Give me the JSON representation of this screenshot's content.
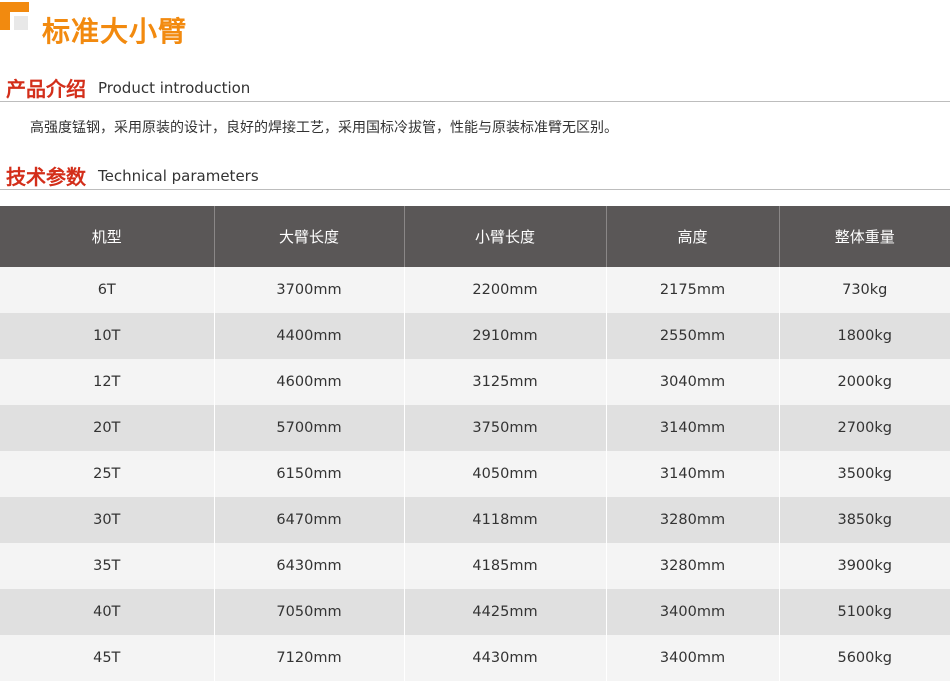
{
  "page_title": "标准大小臂",
  "intro": {
    "title_zh": "产品介绍",
    "title_en": "Product introduction",
    "text": "高强度锰钢，采用原装的设计，良好的焊接工艺，采用国标冷拔管，性能与原装标准臂无区别。"
  },
  "params": {
    "title_zh": "技术参数",
    "title_en": "Technical parameters",
    "headers": [
      "机型",
      "大臂长度",
      "小臂长度",
      "高度",
      "整体重量"
    ],
    "rows": [
      [
        "6T",
        "3700mm",
        "2200mm",
        "2175mm",
        "730kg"
      ],
      [
        "10T",
        "4400mm",
        "2910mm",
        "2550mm",
        "1800kg"
      ],
      [
        "12T",
        "4600mm",
        "3125mm",
        "3040mm",
        "2000kg"
      ],
      [
        "20T",
        "5700mm",
        "3750mm",
        "3140mm",
        "2700kg"
      ],
      [
        "25T",
        "6150mm",
        "4050mm",
        "3140mm",
        "3500kg"
      ],
      [
        "30T",
        "6470mm",
        "4118mm",
        "3280mm",
        "3850kg"
      ],
      [
        "35T",
        "6430mm",
        "4185mm",
        "3280mm",
        "3900kg"
      ],
      [
        "40T",
        "7050mm",
        "4425mm",
        "3400mm",
        "5100kg"
      ],
      [
        "45T",
        "7120mm",
        "4430mm",
        "3400mm",
        "5600kg"
      ]
    ]
  },
  "colors": {
    "accent": "#f28a0f",
    "section_title": "#d32e1a",
    "header_bg": "#5a5757",
    "row_light": "#f4f4f4",
    "row_dark": "#e0e0e0"
  }
}
